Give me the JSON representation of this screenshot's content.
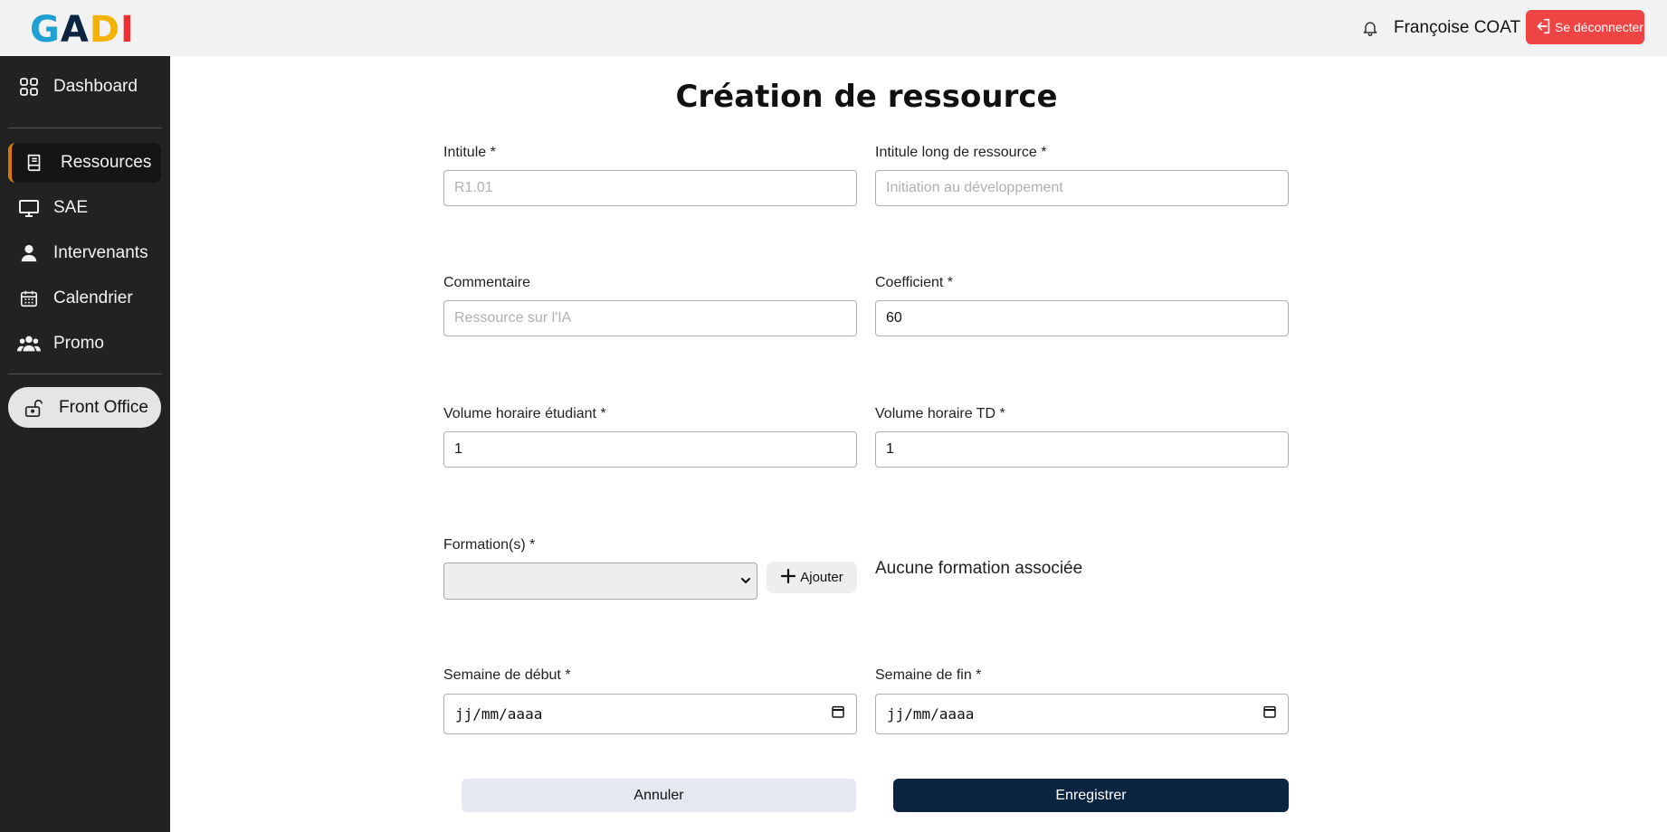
{
  "header": {
    "logo_letters": [
      {
        "char": "G",
        "color": "#1ea0d2"
      },
      {
        "char": "A",
        "color": "#0b2440"
      },
      {
        "char": "D",
        "color": "#f5b301"
      },
      {
        "char": "I",
        "color": "#ef2f2f"
      }
    ],
    "notification_icon": "bell-icon",
    "user_name": "Françoise COAT",
    "logout_label": "Se déconnecter",
    "logout_icon": "logout-icon"
  },
  "sidebar": {
    "items": [
      {
        "label": "Dashboard",
        "icon": "dashboard-grid-icon"
      },
      {
        "label": "Ressources",
        "icon": "book-icon",
        "active": true
      },
      {
        "label": "SAE",
        "icon": "monitor-icon"
      },
      {
        "label": "Intervenants",
        "icon": "user-icon"
      },
      {
        "label": "Calendrier",
        "icon": "calendar-icon"
      },
      {
        "label": "Promo",
        "icon": "users-group-icon"
      }
    ],
    "front_office": {
      "label": "Front Office",
      "icon": "unlock-icon"
    }
  },
  "form": {
    "title": "Création de ressource",
    "intitule": {
      "label": "Intitule *",
      "value": "",
      "placeholder": "R1.01"
    },
    "intitule_long": {
      "label": "Intitule long de ressource *",
      "value": "",
      "placeholder": "Initiation au développement"
    },
    "commentaire": {
      "label": "Commentaire",
      "value": "",
      "placeholder": "Ressource sur l'IA"
    },
    "coefficient": {
      "label": "Coefficient *",
      "value": "60"
    },
    "volume_etudiant": {
      "label": "Volume horaire étudiant *",
      "value": "1"
    },
    "volume_td": {
      "label": "Volume horaire TD *",
      "value": "1"
    },
    "formations": {
      "label": "Formation(s) *",
      "selected": "",
      "add_label": "Ajouter",
      "empty_text": "Aucune formation associée"
    },
    "semaine_debut": {
      "label": "Semaine de début *",
      "value": "jj/mm/aaaa"
    },
    "semaine_fin": {
      "label": "Semaine de fin *",
      "value": "jj/mm/aaaa"
    },
    "cancel_label": "Annuler",
    "save_label": "Enregistrer"
  },
  "colors": {
    "accent_active": "#d97706",
    "logout_bg": "#ef4444",
    "save_bg": "#0b2440",
    "sidebar_bg": "#222222"
  }
}
